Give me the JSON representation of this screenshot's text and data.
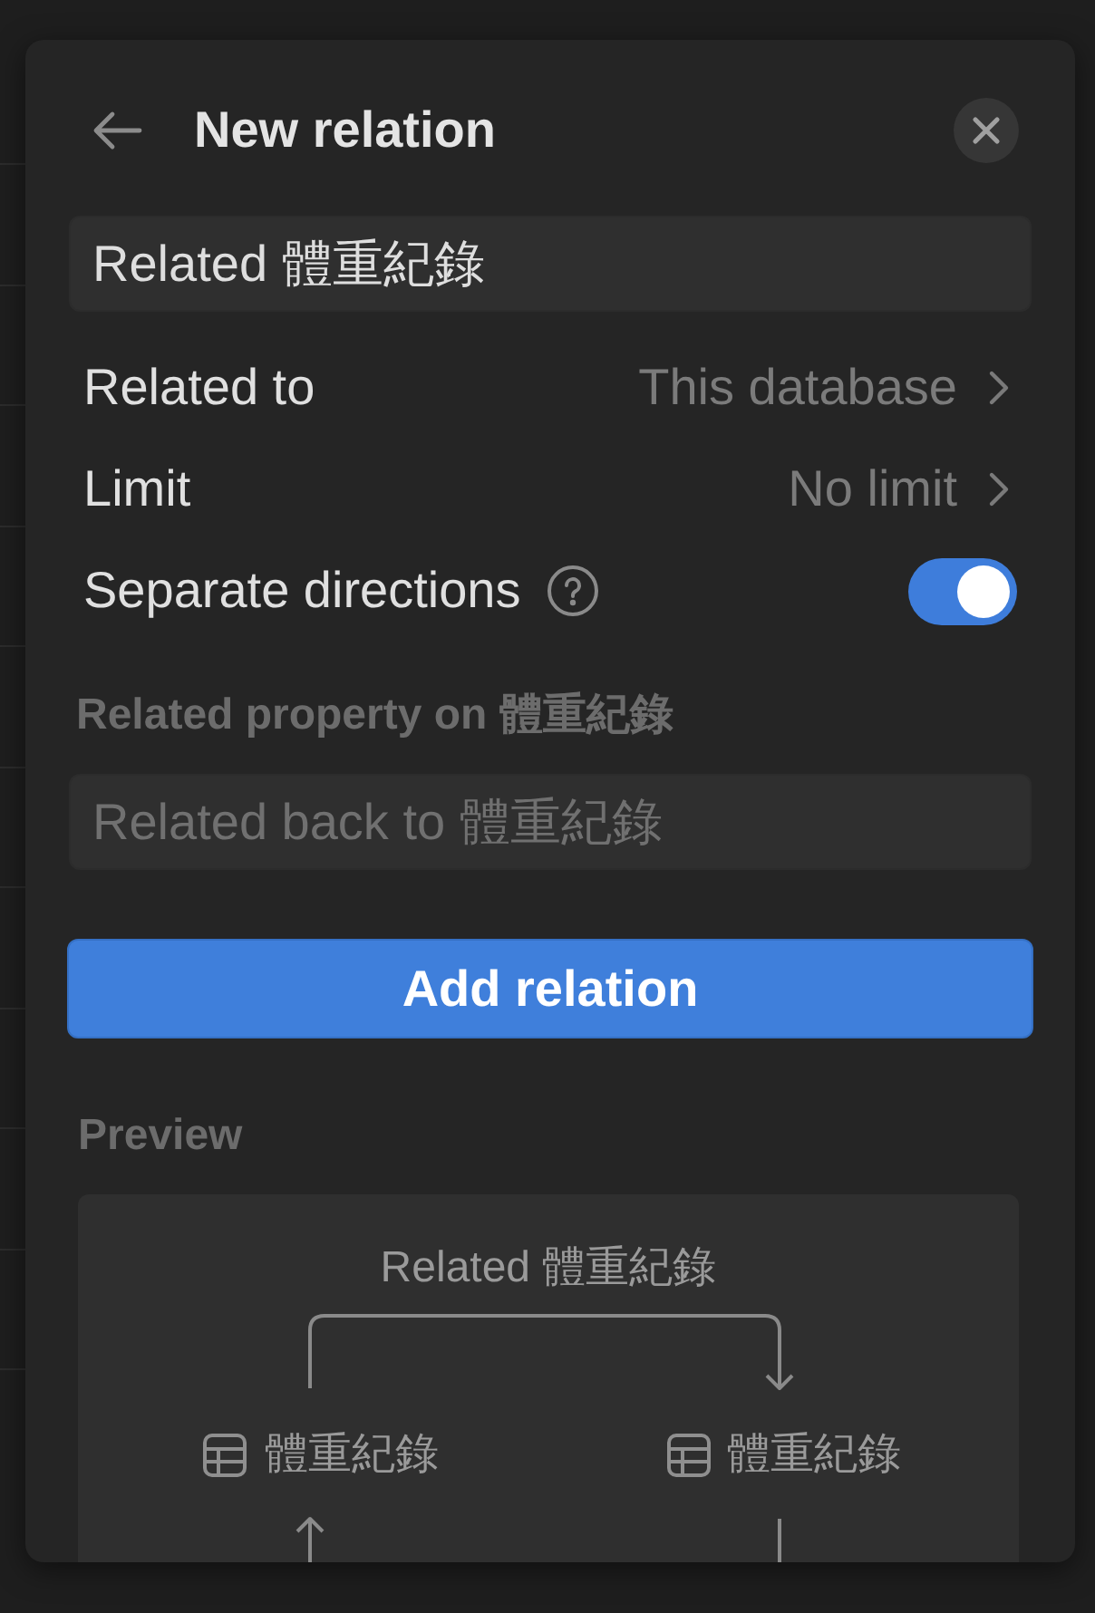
{
  "dialog": {
    "title": "New relation"
  },
  "name_field": {
    "value": "Related 體重紀錄"
  },
  "settings": [
    {
      "kind": "link",
      "label": "Related to",
      "value": "This database"
    },
    {
      "kind": "link",
      "label": "Limit",
      "value": "No limit"
    },
    {
      "kind": "toggle",
      "label": "Separate directions",
      "help": true,
      "on": true
    }
  ],
  "related_property": {
    "label": "Related property on 體重紀錄",
    "placeholder": "Related back to 體重紀錄"
  },
  "primary_button": "Add relation",
  "preview": {
    "label": "Preview",
    "relation_label": "Related 體重紀錄",
    "source": "體重紀錄",
    "target": "體重紀錄"
  }
}
